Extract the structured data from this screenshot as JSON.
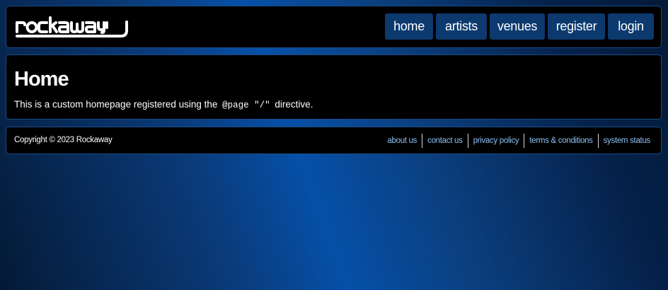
{
  "brand": {
    "logo_text": "rockaway"
  },
  "nav": {
    "items": [
      {
        "label": "home"
      },
      {
        "label": "artists"
      },
      {
        "label": "venues"
      },
      {
        "label": "register"
      },
      {
        "label": "login"
      }
    ]
  },
  "main": {
    "title": "Home",
    "text_before": "This is a custom homepage registered using the ",
    "code": "@page \"/\"",
    "text_after": " directive."
  },
  "footer": {
    "copyright": "Copyright © 2023 Rockaway",
    "links": [
      {
        "label": "about us"
      },
      {
        "label": "contact us"
      },
      {
        "label": "privacy policy"
      },
      {
        "label": "terms & conditions"
      },
      {
        "label": "system status"
      }
    ]
  },
  "colors": {
    "nav_bg": "#0c3a6e",
    "panel_bg": "#000000",
    "link": "#8cc0f5"
  }
}
